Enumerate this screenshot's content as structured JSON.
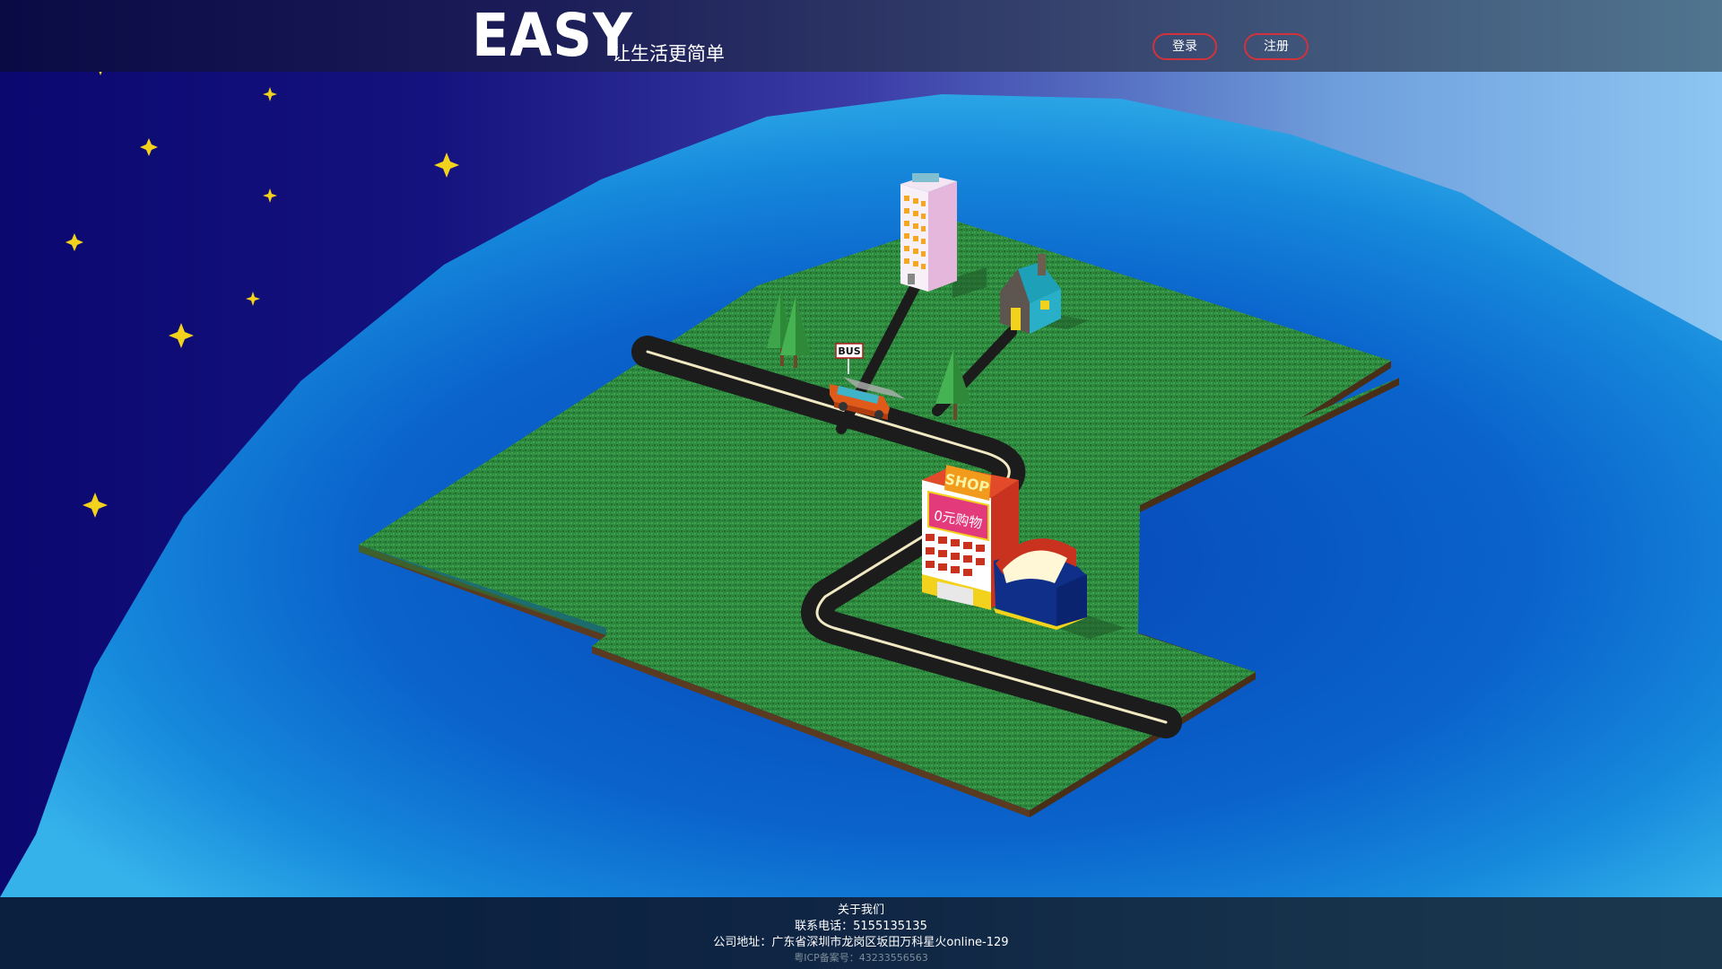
{
  "header": {
    "logo": "EASY",
    "slogan": "让生活更简单",
    "login_label": "登录",
    "register_label": "注册"
  },
  "scene": {
    "bus_sign": "BUS",
    "shop_sign": "SHOP",
    "shop_banner": "0元购物"
  },
  "footer": {
    "about": "关于我们",
    "phone": "联系电话：5155135135",
    "address": "公司地址：广东省深圳市龙岗区坂田万科星火online-129",
    "icp": "粤ICP备案号：43233556563"
  },
  "colors": {
    "accent_border": "#d2323c",
    "grass": "#2f8a3c",
    "road": "#1d1d1d",
    "ocean": "#0a64c8",
    "star": "#f2d21c"
  }
}
